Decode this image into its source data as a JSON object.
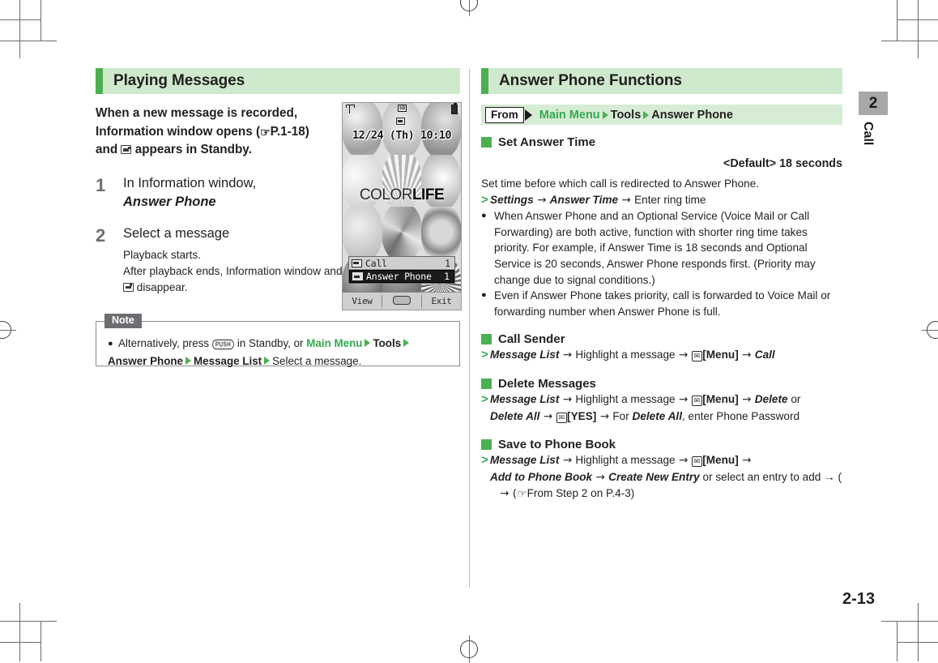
{
  "document": {
    "page_number": "2-13",
    "chapter_number": "2",
    "chapter_label": "Call",
    "accent_green": "#4cb050",
    "header_green_bg": "#cfe9cd",
    "crumb_green_bg": "#d7ecd4",
    "link_green": "#34a853",
    "note_tab_gray": "#6d6e71"
  },
  "left": {
    "section_title": "Playing Messages",
    "intro": {
      "line1": "When a new message is recorded,",
      "line2_a": "Information window opens (",
      "line2_ref": "P.1-18",
      "line2_b": ")",
      "line3_a": "and",
      "line3_b": "appears in Standby."
    },
    "steps": [
      {
        "num": "1",
        "title_plain": "In Information window,",
        "title_em": "Answer Phone",
        "sub": []
      },
      {
        "num": "2",
        "title_plain": "Select a message",
        "title_em": "",
        "sub": [
          "Playback starts.",
          "After playback ends, Information window and",
          "disappear."
        ]
      }
    ],
    "note": {
      "label": "Note",
      "bullet": "●",
      "text_a": "Alternatively, press",
      "key_label": "PUSH",
      "text_b": "in Standby, or",
      "crumb1": "Main Menu",
      "crumb2": "Tools",
      "crumb3": "Answer Phone",
      "crumb4": "Message List",
      "text_c": "Select a message."
    }
  },
  "phone": {
    "status": {
      "signal_icon": "signal-icon",
      "sd_icon_label": "SD",
      "battery_icon": "battery-icon",
      "mail_icon": "answer-phone-icon"
    },
    "clock": "12/24 (Th) 10:10",
    "brand_light": "COLOR",
    "brand_heavy": "LIFE",
    "info_window": [
      {
        "icon": "missed-call-icon",
        "label": "Call",
        "count": "1",
        "selected": false
      },
      {
        "icon": "answer-phone-icon",
        "label": "Answer Phone",
        "count": "1",
        "selected": true
      }
    ],
    "softkeys": {
      "left": "View",
      "center": "center-key",
      "right": "Exit"
    }
  },
  "right": {
    "section_title": "Answer Phone Functions",
    "breadcrumb": {
      "from_label": "From",
      "items": [
        "Main Menu",
        "Tools",
        "Answer Phone"
      ]
    },
    "blocks": [
      {
        "heading": "Set Answer Time",
        "default_label": "<Default>",
        "default_value": "18 seconds",
        "intro": "Set time before which call is redirected to Answer Phone.",
        "path": {
          "parts": [
            {
              "t": "Settings",
              "s": "bi"
            },
            {
              "t": " → ",
              "s": "arw"
            },
            {
              "t": "Answer Time",
              "s": "bi"
            },
            {
              "t": " → ",
              "s": "arw"
            },
            {
              "t": "Enter ring time",
              "s": ""
            }
          ]
        },
        "bullets": [
          "When Answer Phone and an Optional Service (Voice Mail or Call Forwarding) are both active, function with shorter ring time takes priority. For example, if Answer Time is 18 seconds and Optional Service is 20 seconds, Answer Phone responds first. (Priority may change due to signal conditions.)",
          "Even if Answer Phone takes priority, call is forwarded to Voice Mail or forwarding number when Answer Phone is full."
        ]
      },
      {
        "heading": "Call Sender",
        "path": {
          "parts": [
            {
              "t": "Message List",
              "s": "bi"
            },
            {
              "t": " → ",
              "s": "arw"
            },
            {
              "t": "Highlight a message",
              "s": ""
            },
            {
              "t": " → ",
              "s": "arw"
            },
            {
              "t": "MAILKEY",
              "s": "key"
            },
            {
              "t": "[Menu]",
              "s": "b"
            },
            {
              "t": " → ",
              "s": "arw"
            },
            {
              "t": "Call",
              "s": "bi"
            }
          ]
        },
        "bullets": []
      },
      {
        "heading": "Delete Messages",
        "path": {
          "parts": [
            {
              "t": "Message List",
              "s": "bi"
            },
            {
              "t": " → ",
              "s": "arw"
            },
            {
              "t": "Highlight a message",
              "s": ""
            },
            {
              "t": " → ",
              "s": "arw"
            },
            {
              "t": "MAILKEY",
              "s": "key"
            },
            {
              "t": "[Menu]",
              "s": "b"
            },
            {
              "t": " → ",
              "s": "arw"
            },
            {
              "t": "Delete",
              "s": "bi"
            },
            {
              "t": " or ",
              "s": ""
            },
            {
              "t": "Delete All",
              "s": "bi"
            },
            {
              "t": " → ",
              "s": "arw"
            },
            {
              "t": "MAILKEY",
              "s": "key"
            },
            {
              "t": "[YES]",
              "s": "b"
            },
            {
              "t": " → ",
              "s": "arw"
            },
            {
              "t": "For ",
              "s": ""
            },
            {
              "t": "Delete All",
              "s": "bi"
            },
            {
              "t": ", enter Phone Password",
              "s": ""
            }
          ]
        },
        "bullets": []
      },
      {
        "heading": "Save to Phone Book",
        "path": {
          "parts": [
            {
              "t": "Message List",
              "s": "bi"
            },
            {
              "t": " → ",
              "s": "arw"
            },
            {
              "t": "Highlight a message",
              "s": ""
            },
            {
              "t": " → ",
              "s": "arw"
            },
            {
              "t": "MAILKEY",
              "s": "key"
            },
            {
              "t": "[Menu]",
              "s": "b"
            },
            {
              "t": " → ",
              "s": "arw"
            },
            {
              "t": "Add to Phone Book",
              "s": "bi"
            },
            {
              "t": " → ",
              "s": "arw"
            },
            {
              "t": "Create New Entry",
              "s": "bi"
            },
            {
              "t": " or select an entry to add → (",
              "s": ""
            },
            {
              "t": "REF",
              "s": "ref"
            },
            {
              "t": "From Step 2 on P.4-3)",
              "s": ""
            }
          ]
        },
        "bullets": []
      }
    ]
  }
}
